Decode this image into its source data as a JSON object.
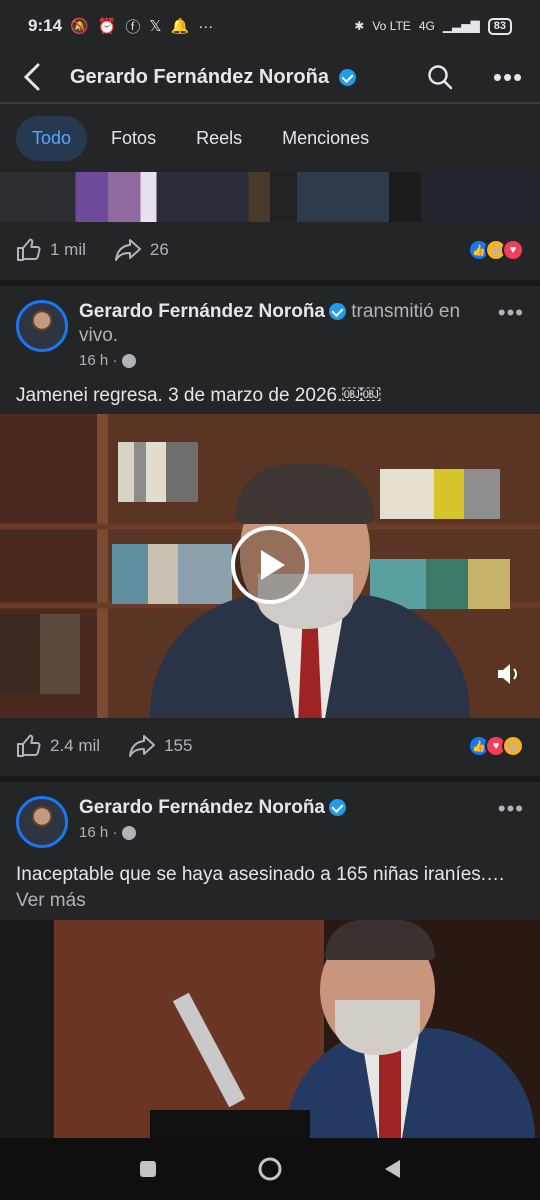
{
  "status_bar": {
    "time": "9:14",
    "battery": "83",
    "network": "4G",
    "volte": "Vo LTE"
  },
  "app_bar": {
    "title": "Gerardo Fernández Noroña"
  },
  "tabs": [
    {
      "label": "Todo",
      "active": true
    },
    {
      "label": "Fotos",
      "active": false
    },
    {
      "label": "Reels",
      "active": false
    },
    {
      "label": "Menciones",
      "active": false
    }
  ],
  "prev_post": {
    "likes": "1 mil",
    "shares": "26",
    "reactions": [
      "like-icon",
      "haha-icon",
      "love-icon"
    ]
  },
  "post1": {
    "author": "Gerardo Fernández Noroña",
    "action": "transmitió en vivo.",
    "time": "16 h ·",
    "text": "Jamenei regresa. 3 de marzo de 2026.￼￼",
    "likes": "2.4 mil",
    "shares": "155",
    "reactions": [
      "like-icon",
      "love-icon",
      "haha-icon"
    ]
  },
  "post2": {
    "author": "Gerardo Fernández Noroña",
    "time": "16 h ·",
    "text": "Inaceptable que se haya asesinado a 165 niñas iraníes.…",
    "see_more": "Ver más"
  },
  "colors": {
    "background": "#18191a",
    "card": "#242526",
    "accent": "#5aa7ff",
    "verified": "#1d9bf0"
  }
}
